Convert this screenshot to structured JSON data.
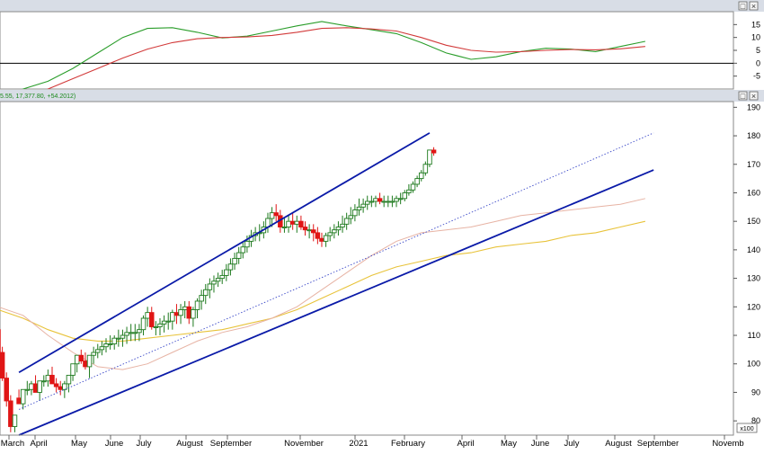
{
  "window": {
    "panel_buttons": [
      "□",
      "×"
    ],
    "price_info": "5.55, 17,377.80, +54.2012)"
  },
  "colors": {
    "background": "#ffffff",
    "panel_border": "#8a8a8a",
    "header_bar": "#d8dde6",
    "axis_text": "#000000",
    "candle_up": "#ffffff",
    "candle_up_outline": "#1e7a1e",
    "candle_down": "#e01515",
    "oscillator_fast": "#2a9d2a",
    "oscillator_slow": "#d23a3a",
    "zero_line": "#000000",
    "channel_line": "#0a1aa8",
    "midline": "#3a48c8",
    "ma_short": "#e7b3a4",
    "ma_long": "#e8c33a",
    "price_info_text": "#1b8a1b"
  },
  "axis": {
    "scale_label": "x100",
    "x_ticks": [
      "March",
      "April",
      "May",
      "June",
      "July",
      "August",
      "September",
      "November",
      "2021",
      "February",
      "April",
      "May",
      "June",
      "July",
      "August",
      "September",
      "Novemb"
    ]
  },
  "chart_data": [
    {
      "type": "line",
      "title": "",
      "ylim": [
        -10,
        20
      ],
      "yticks": [
        -5,
        0,
        5,
        10,
        15
      ],
      "zero_line": true,
      "series": [
        {
          "key": "fast",
          "color": "#2a9d2a",
          "x": [
            0,
            3,
            6,
            9,
            12,
            15,
            18,
            21,
            24,
            27,
            30,
            33,
            36,
            39,
            42,
            45,
            48,
            51,
            54,
            57,
            60,
            63,
            66,
            69,
            72,
            75,
            78
          ],
          "y": [
            -14,
            -10,
            -7,
            -2,
            4,
            10,
            13.5,
            13.8,
            12,
            9.8,
            10.5,
            12.5,
            14.5,
            16.2,
            14.5,
            13,
            11.5,
            8,
            4,
            1.5,
            2.5,
            4.5,
            5.8,
            5.5,
            4.5,
            6.5,
            8.5
          ]
        },
        {
          "key": "slow",
          "color": "#d23a3a",
          "x": [
            0,
            3,
            6,
            9,
            12,
            15,
            18,
            21,
            24,
            27,
            30,
            33,
            36,
            39,
            42,
            45,
            48,
            51,
            54,
            57,
            60,
            63,
            66,
            69,
            72,
            75,
            78
          ],
          "y": [
            -18,
            -14,
            -10,
            -6,
            -2,
            2,
            5.5,
            8,
            9.5,
            10,
            10.2,
            10.8,
            12,
            13.5,
            13.8,
            13.3,
            12.5,
            10,
            7,
            5,
            4.3,
            4.5,
            5,
            5.3,
            5.2,
            5.6,
            6.5
          ]
        }
      ]
    },
    {
      "type": "candlestick",
      "title": "",
      "ylim": [
        75,
        192
      ],
      "yticks": [
        80,
        90,
        100,
        110,
        120,
        130,
        140,
        150,
        160,
        170,
        180,
        190
      ],
      "candles": {
        "x": [
          0,
          0.5,
          1,
          1.5,
          2,
          2.5,
          3,
          3.5,
          4,
          4.5,
          5,
          5.5,
          6,
          6.5,
          7,
          7.5,
          8,
          8.5,
          9,
          9.5,
          10,
          10.5,
          11,
          11.5,
          12,
          12.5,
          13,
          13.5,
          14,
          14.5,
          15,
          15.5,
          16,
          16.5,
          17,
          17.5,
          18,
          18.5,
          19,
          19.5,
          20,
          20.5,
          21,
          21.5,
          22,
          22.5,
          23,
          23.5,
          24,
          24.5,
          25,
          25.5,
          26,
          26.5,
          27,
          27.5,
          28,
          28.5,
          29,
          29.5,
          30,
          30.5,
          31,
          31.5,
          32,
          32.5,
          33,
          33.5,
          34,
          34.5,
          35,
          35.5,
          36,
          36.5,
          37,
          37.5,
          38,
          38.5,
          39,
          39.5,
          40,
          40.5,
          41,
          41.5,
          42,
          42.5,
          43,
          43.5,
          44,
          44.5,
          45,
          45.5,
          46,
          46.5,
          47,
          47.5,
          48,
          48.5,
          49,
          49.5,
          50,
          50.5,
          51,
          51.5,
          52,
          52.5,
          53,
          53.5,
          54,
          54.5,
          55,
          55.5,
          56,
          56.5,
          57,
          57.5,
          58,
          58.5,
          59,
          59.5,
          60,
          60.5,
          61,
          61.5,
          62,
          62.5,
          63,
          63.5,
          64,
          64.5,
          65,
          65.5,
          66,
          66.5,
          67,
          67.5,
          68,
          68.5,
          69,
          69.5,
          70,
          70.5,
          71,
          71.5,
          72,
          72.5,
          73,
          73.5,
          74,
          74.5,
          75,
          75.5,
          76,
          76.5,
          77,
          77.5,
          78,
          78.5
        ],
        "o": [
          112,
          104,
          95,
          87,
          78,
          88,
          86,
          91,
          91,
          93,
          90,
          94,
          94,
          96,
          93,
          92,
          91,
          93,
          96,
          100,
          103,
          101,
          99,
          103,
          104,
          105,
          106,
          107,
          107,
          109,
          109,
          110,
          111,
          111,
          111,
          112,
          116,
          118,
          113,
          113,
          114,
          115,
          115,
          118,
          117,
          119,
          120,
          116,
          119,
          122,
          124,
          126,
          128,
          129,
          130,
          131,
          133,
          135,
          137,
          139,
          141,
          143,
          145,
          146,
          146,
          148,
          151,
          153,
          152,
          148,
          148,
          150,
          149,
          150,
          148,
          147,
          147,
          146,
          144,
          143,
          145,
          146,
          147,
          148,
          149,
          151,
          152,
          154,
          155,
          156,
          157,
          157,
          158,
          157,
          157,
          157,
          157,
          158,
          158,
          160,
          161,
          163,
          165,
          167,
          170,
          175
        ],
        "h": [
          114,
          106,
          97,
          89,
          80,
          91,
          91,
          94,
          94,
          96,
          93,
          96,
          98,
          99,
          95,
          94,
          94,
          96,
          100,
          103,
          105,
          104,
          102,
          106,
          107,
          108,
          109,
          110,
          110,
          112,
          112,
          113,
          114,
          114,
          114,
          117,
          120,
          120,
          115,
          116,
          117,
          118,
          119,
          121,
          121,
          122,
          122,
          120,
          123,
          126,
          128,
          130,
          131,
          132,
          133,
          135,
          137,
          139,
          141,
          143,
          145,
          147,
          148,
          149,
          150,
          153,
          155,
          156,
          154,
          151,
          152,
          153,
          152,
          152,
          150,
          149,
          149,
          148,
          146,
          146,
          148,
          149,
          150,
          152,
          153,
          155,
          156,
          158,
          158,
          159,
          159,
          159,
          160,
          159,
          159,
          159,
          159,
          160,
          161,
          163,
          164,
          166,
          168,
          171,
          175,
          176
        ],
        "l": [
          102,
          94,
          85,
          76,
          76,
          86,
          84,
          89,
          89,
          90,
          87,
          92,
          92,
          93,
          90,
          89,
          88,
          90,
          94,
          97,
          100,
          98,
          95,
          100,
          102,
          103,
          104,
          105,
          105,
          106,
          106,
          107,
          108,
          108,
          108,
          110,
          113,
          112,
          110,
          110,
          111,
          112,
          112,
          114,
          114,
          116,
          114,
          113,
          116,
          119,
          121,
          123,
          125,
          127,
          128,
          129,
          131,
          133,
          135,
          137,
          139,
          141,
          143,
          143,
          144,
          146,
          148,
          150,
          146,
          146,
          146,
          147,
          146,
          147,
          145,
          144,
          143,
          142,
          141,
          141,
          143,
          144,
          145,
          146,
          147,
          149,
          150,
          152,
          153,
          154,
          155,
          155,
          156,
          155,
          155,
          155,
          155,
          156,
          157,
          159,
          160,
          162,
          164,
          166,
          169,
          173
        ],
        "c": [
          104,
          95,
          87,
          78,
          82,
          86,
          91,
          91,
          93,
          90,
          94,
          94,
          96,
          93,
          92,
          91,
          93,
          96,
          100,
          103,
          101,
          99,
          103,
          104,
          105,
          106,
          107,
          107,
          109,
          109,
          110,
          111,
          111,
          111,
          112,
          116,
          118,
          113,
          113,
          114,
          115,
          115,
          118,
          117,
          119,
          120,
          116,
          119,
          122,
          124,
          126,
          128,
          129,
          130,
          131,
          133,
          135,
          137,
          139,
          141,
          143,
          145,
          146,
          146,
          148,
          151,
          153,
          152,
          148,
          148,
          150,
          149,
          150,
          148,
          147,
          147,
          146,
          144,
          143,
          145,
          146,
          147,
          148,
          149,
          151,
          152,
          154,
          155,
          156,
          157,
          157,
          158,
          157,
          157,
          157,
          157,
          158,
          158,
          160,
          161,
          163,
          165,
          167,
          170,
          175,
          174
        ]
      },
      "ma_short": {
        "x": [
          0,
          3,
          6,
          9,
          12,
          15,
          18,
          21,
          24,
          27,
          30,
          33,
          36,
          39,
          42,
          45,
          48,
          51,
          54,
          57,
          60,
          63,
          66,
          69,
          72,
          75,
          78
        ],
        "y": [
          120,
          117,
          110,
          104,
          99,
          98,
          100,
          104,
          108,
          111,
          113,
          116,
          120,
          126,
          132,
          138,
          143,
          146,
          147,
          148,
          150,
          152,
          153,
          154,
          155,
          156,
          158
        ]
      },
      "ma_long": {
        "x": [
          0,
          3,
          6,
          9,
          12,
          15,
          18,
          21,
          24,
          27,
          30,
          33,
          36,
          39,
          42,
          45,
          48,
          51,
          54,
          57,
          60,
          63,
          66,
          69,
          72,
          75,
          78
        ],
        "y": [
          119,
          116,
          112,
          109,
          108,
          108,
          109,
          110,
          111,
          112,
          114,
          116,
          119,
          123,
          127,
          131,
          134,
          136,
          138,
          139,
          141,
          142,
          143,
          145,
          146,
          148,
          150
        ]
      },
      "channel": {
        "upper": [
          [
            2.5,
            97
          ],
          [
            52,
            181
          ]
        ],
        "lower": [
          [
            2.5,
            75
          ],
          [
            79,
            168
          ]
        ],
        "mid": [
          [
            2.5,
            84
          ],
          [
            79,
            181
          ]
        ]
      }
    }
  ]
}
